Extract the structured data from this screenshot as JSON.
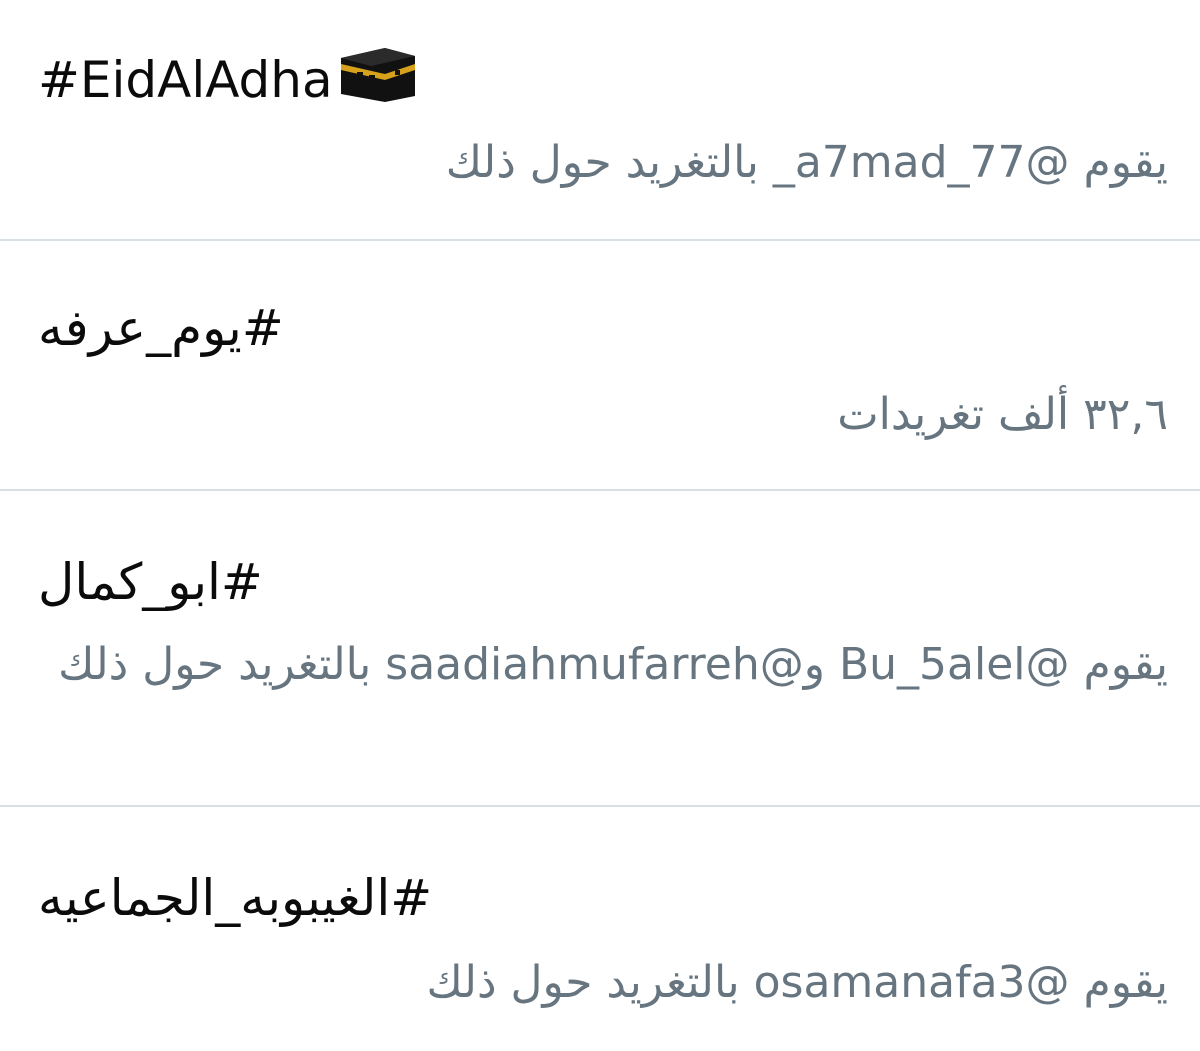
{
  "trends": [
    {
      "title": "#EidAlAdha",
      "icon": "kaaba-icon",
      "meta": "يقوم @a7mad_77_ بالتغريد حول ذلك"
    },
    {
      "title": "#يوم_عرفه",
      "meta": "٣٢,٦ ألف تغريدات"
    },
    {
      "title": "#ابو_كمال",
      "meta": "يقوم @Bu_5alel و@saadiahmufarreh بالتغريد حول ذلك"
    },
    {
      "title": "#الغيبوبه_الجماعيه",
      "meta": "يقوم @osamanafa3 بالتغريد حول ذلك"
    }
  ],
  "colors": {
    "title": "#0b0b0b",
    "meta": "#66757f",
    "divider": "#d7dfe5",
    "kaaba_gold": "#d6a21c"
  }
}
